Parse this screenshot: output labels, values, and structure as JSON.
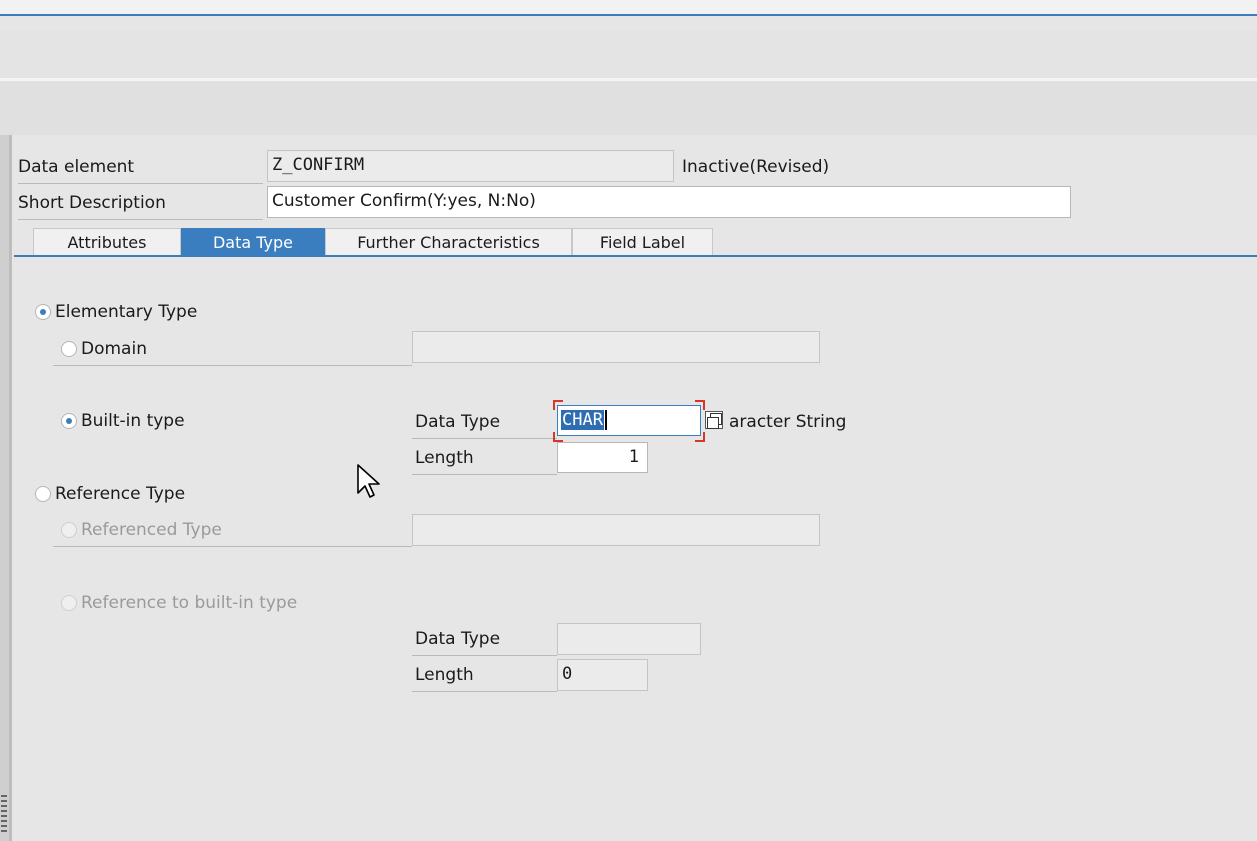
{
  "header": {
    "data_element_label": "Data element",
    "data_element_value": "Z_CONFIRM",
    "status": "Inactive(Revised)",
    "short_desc_label": "Short Description",
    "short_desc_value": "Customer Confirm(Y:yes, N:No)"
  },
  "tabs": [
    {
      "label": "Attributes",
      "active": false
    },
    {
      "label": "Data Type",
      "active": true
    },
    {
      "label": "Further Characteristics",
      "active": false
    },
    {
      "label": "Field Label",
      "active": false
    }
  ],
  "elementary": {
    "label": "Elementary Type",
    "selected": true,
    "domain": {
      "label": "Domain",
      "selected": false,
      "value": ""
    },
    "builtin": {
      "label": "Built-in type",
      "selected": true,
      "data_type_label": "Data Type",
      "data_type_value": "CHAR",
      "data_type_description": "aracter String",
      "length_label": "Length",
      "length_value": "1"
    }
  },
  "reference": {
    "label": "Reference Type",
    "selected": false,
    "referenced": {
      "label": "Referenced Type",
      "value": ""
    },
    "ref_builtin": {
      "label": "Reference to built-in type",
      "data_type_label": "Data Type",
      "data_type_value": "",
      "length_label": "Length",
      "length_value": "0"
    }
  },
  "colors": {
    "accent": "#3a7ec0",
    "focus_corner": "#d9352b"
  }
}
